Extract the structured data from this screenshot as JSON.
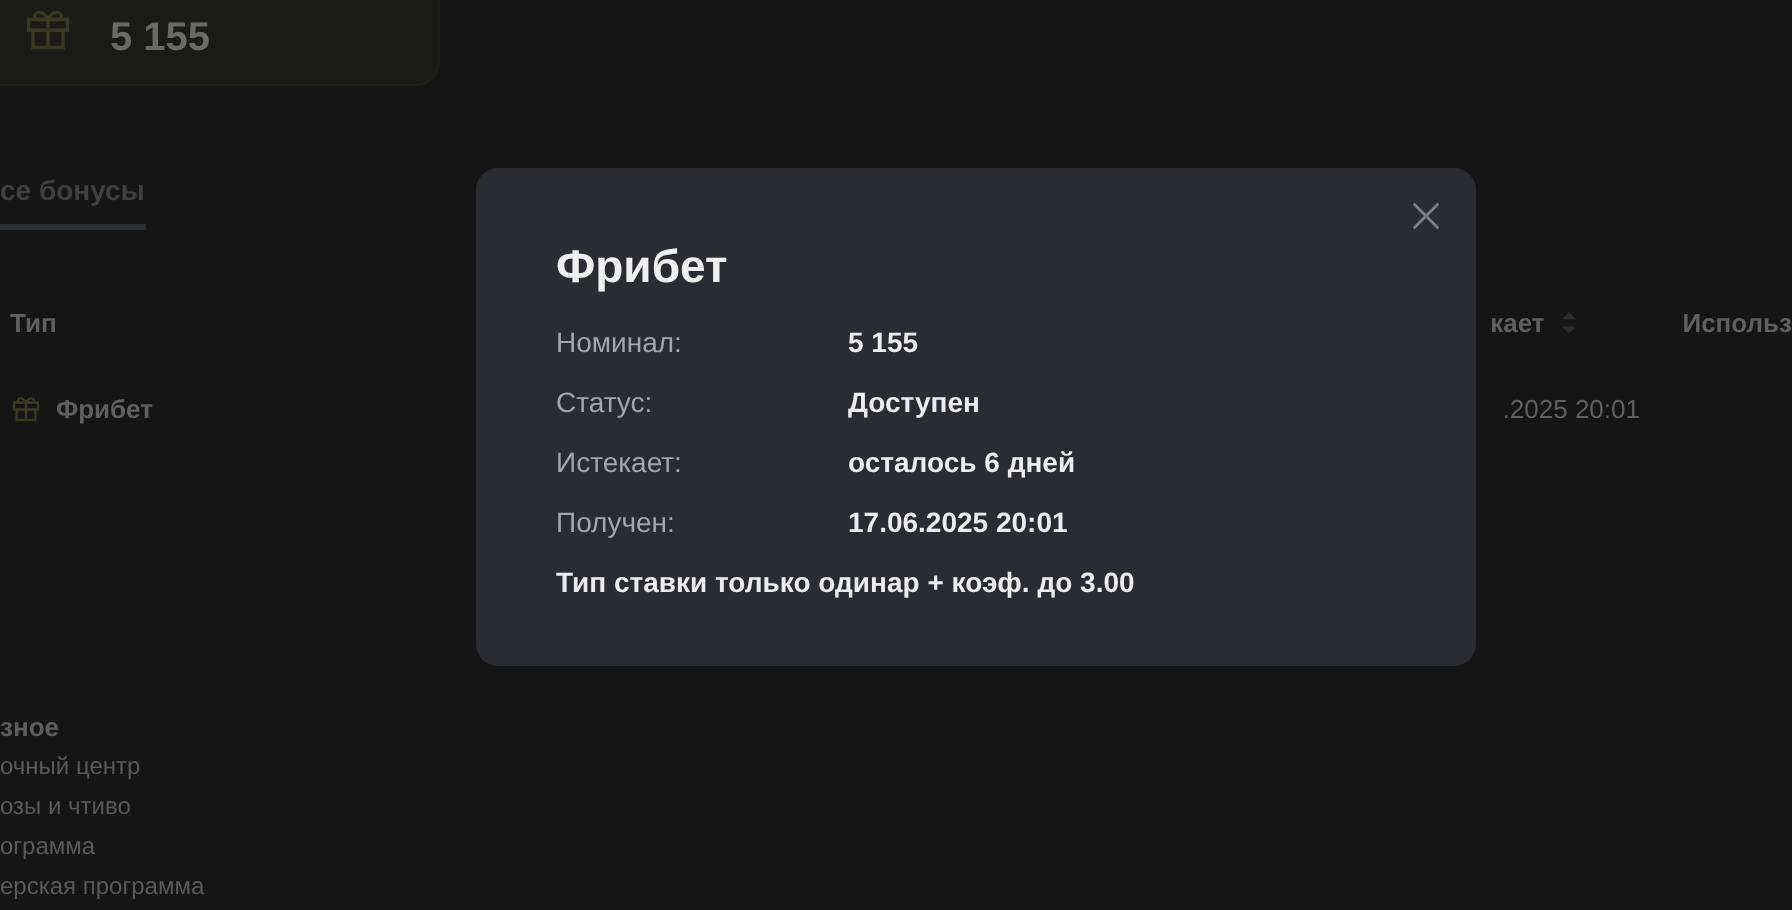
{
  "summary_card": {
    "value": "5 155"
  },
  "tabs": [
    {
      "label": "се бонусы",
      "selected": true
    }
  ],
  "table": {
    "columns": [
      "Тип",
      "кает",
      "Использ"
    ],
    "rows": [
      {
        "type": "Фрибет",
        "column_2": ".2025 20:01"
      }
    ]
  },
  "footer": {
    "heading": "зное",
    "links": [
      "очный центр",
      "озы и чтиво",
      "ограмма",
      "ерская программа"
    ]
  },
  "modal": {
    "title": "Фрибет",
    "fields": [
      {
        "label": "Номинал:",
        "value": "5 155"
      },
      {
        "label": "Статус:",
        "value": "Доступен"
      },
      {
        "label": "Истекает:",
        "value": "осталось 6 дней"
      },
      {
        "label": "Получен:",
        "value": "17.06.2025 20:01"
      }
    ],
    "note": "Тип ставки только одинар + коэф. до 3.00"
  }
}
